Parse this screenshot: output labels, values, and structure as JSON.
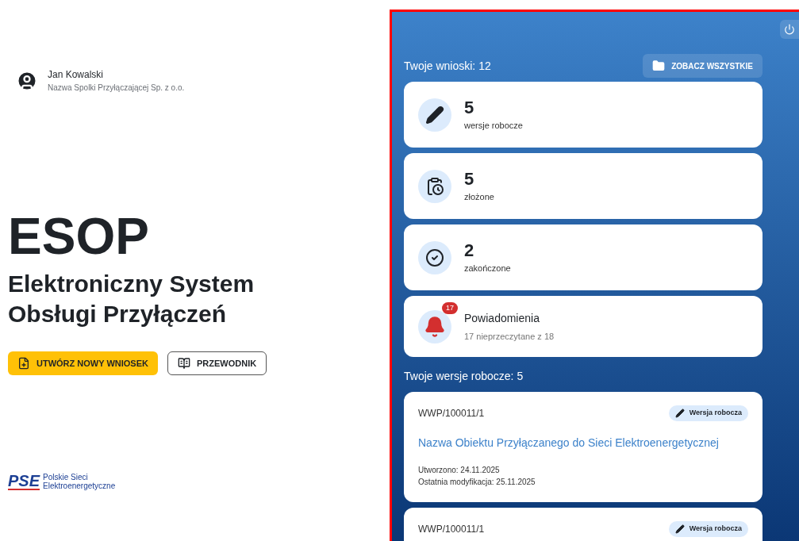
{
  "user": {
    "name": "Jan Kowalski",
    "company": "Nazwa Spolki Przyłączającej Sp. z o.o."
  },
  "hero": {
    "title": "ESOP",
    "subtitle": "Elektroniczny System Obsługi Przyłączeń"
  },
  "actions": [
    {
      "label": "UTWÓRZ NOWY WNIOSEK",
      "kind": "primary"
    },
    {
      "label": "PRZEWODNIK",
      "kind": "outline"
    }
  ],
  "logo": {
    "mark": "PSE",
    "line1": "Polskie Sieci",
    "line2": "Elektroenergetyczne"
  },
  "applications": {
    "heading": "Twoje wnioski: 12",
    "view_all": "ZOBACZ WSZYSTKIE"
  },
  "stats": [
    {
      "kind": "drafts",
      "value": "5",
      "label": "wersje robocze"
    },
    {
      "kind": "submitted",
      "value": "5",
      "label": "złożone"
    },
    {
      "kind": "completed",
      "value": "2",
      "label": "zakończone"
    },
    {
      "kind": "notifications",
      "value": "Powiadomienia",
      "label": "17 nieprzeczytane z 18",
      "badge": "17"
    }
  ],
  "drafts": {
    "heading": "Twoje wersje robocze: 5",
    "items": [
      {
        "id": "WWP/100011/1",
        "status": "Wersja robocza",
        "title": "Nazwa Obiektu Przyłączanego do Sieci Elektroenergetycznej",
        "created": "Utworzono: 24.11.2025",
        "modified": "Ostatnia modyfikacja: 25.11.2025"
      },
      {
        "id": "WWP/100011/1",
        "status": "Wersja robocza"
      }
    ]
  }
}
